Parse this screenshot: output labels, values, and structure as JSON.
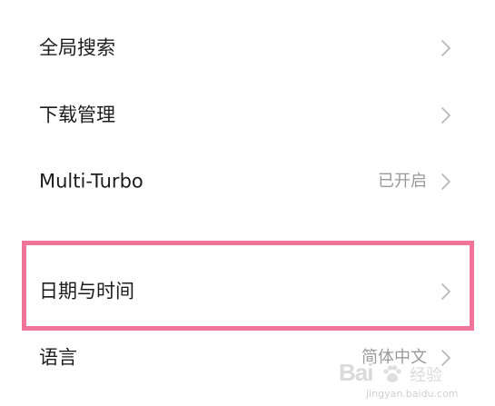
{
  "settings": {
    "items": [
      {
        "label": "全局搜索",
        "value": ""
      },
      {
        "label": "下载管理",
        "value": ""
      },
      {
        "label": "Multi-Turbo",
        "value": "已开启"
      },
      {
        "label": "日期与时间",
        "value": ""
      },
      {
        "label": "语言",
        "value": "简体中文"
      }
    ]
  },
  "highlight": {
    "color": "#f0739a"
  },
  "watermark": {
    "brand": "Bai",
    "sub": "经验",
    "url": "jingyan.baidu.com"
  },
  "icons": {
    "chevron": "chevron-right-icon"
  }
}
